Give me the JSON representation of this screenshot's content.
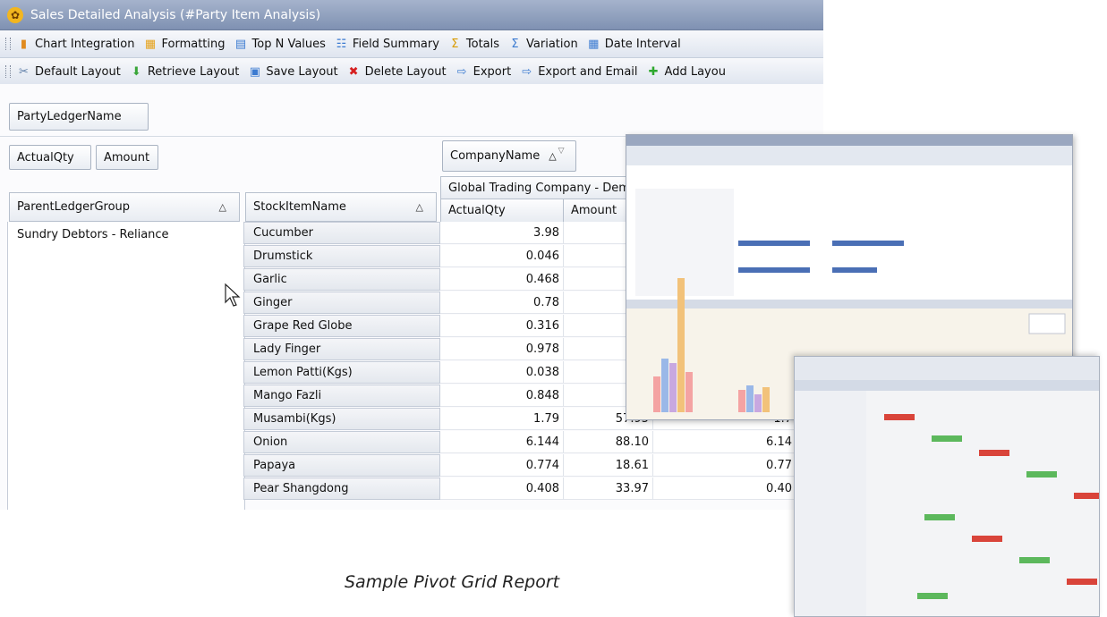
{
  "window": {
    "title": "Sales Detailed Analysis  (#Party Item Analysis)"
  },
  "toolbar1": [
    {
      "label": "Chart Integration",
      "icon": "chart-icon",
      "color": "#e08a1e"
    },
    {
      "label": "Formatting",
      "icon": "formatting-icon",
      "color": "#e6a21a"
    },
    {
      "label": "Top N Values",
      "icon": "top-n-icon",
      "color": "#3c7bd1"
    },
    {
      "label": "Field Summary",
      "icon": "field-summary-icon",
      "color": "#3c7bd1"
    },
    {
      "label": "Totals",
      "icon": "sigma-icon",
      "color": "#d99b00"
    },
    {
      "label": "Variation",
      "icon": "variation-icon",
      "color": "#3c7bd1"
    },
    {
      "label": "Date Interval",
      "icon": "calendar-icon",
      "color": "#3c7bd1"
    }
  ],
  "toolbar2": [
    {
      "label": "Default Layout",
      "icon": "tools-icon",
      "color": "#5f7fa8"
    },
    {
      "label": "Retrieve Layout",
      "icon": "download-icon",
      "color": "#3aa63a"
    },
    {
      "label": "Save Layout",
      "icon": "save-icon",
      "color": "#3c7bd1"
    },
    {
      "label": "Delete Layout",
      "icon": "delete-x-icon",
      "color": "#d62020"
    },
    {
      "label": "Export",
      "icon": "export-icon",
      "color": "#3c7bd1"
    },
    {
      "label": "Export and Email",
      "icon": "export-email-icon",
      "color": "#3c7bd1"
    },
    {
      "label": "Add Layou",
      "icon": "add-icon",
      "color": "#2ea82e"
    }
  ],
  "pivot": {
    "filter_field": "PartyLedgerName",
    "data_fields": [
      "ActualQty",
      "Amount"
    ],
    "column_field": "CompanyName",
    "row_fields": [
      "ParentLedgerGroup",
      "StockItemName"
    ],
    "company_header": "Global Trading Company - Dem",
    "value_headers": [
      "ActualQty",
      "Amount"
    ],
    "group_value": "Sundry Debtors - Reliance",
    "rows": [
      {
        "item": "Cucumber",
        "qty": "3.98",
        "amount": "",
        "qty2": ""
      },
      {
        "item": "Drumstick",
        "qty": "0.046",
        "amount": "",
        "qty2": ""
      },
      {
        "item": "Garlic",
        "qty": "0.468",
        "amount": "",
        "qty2": ""
      },
      {
        "item": "Ginger",
        "qty": "0.78",
        "amount": "",
        "qty2": ""
      },
      {
        "item": "Grape Red Globe",
        "qty": "0.316",
        "amount": "",
        "qty2": ""
      },
      {
        "item": "Lady Finger",
        "qty": "0.978",
        "amount": "",
        "qty2": ""
      },
      {
        "item": "Lemon Patti(Kgs)",
        "qty": "0.038",
        "amount": "",
        "qty2": ""
      },
      {
        "item": "Mango Fazli",
        "qty": "0.848",
        "amount": "",
        "qty2": ""
      },
      {
        "item": "Musambi(Kgs)",
        "qty": "1.79",
        "amount": "57.95",
        "qty2": "1.7"
      },
      {
        "item": "Onion",
        "qty": "6.144",
        "amount": "88.10",
        "qty2": "6.14"
      },
      {
        "item": "Papaya",
        "qty": "0.774",
        "amount": "18.61",
        "qty2": "0.77"
      },
      {
        "item": "Pear Shangdong",
        "qty": "0.408",
        "amount": "33.97",
        "qty2": "0.40"
      }
    ]
  },
  "caption": "Sample Pivot Grid Report",
  "colors": {
    "titlebar": "#8f9fbd",
    "accent_blue": "#4a6fb5",
    "red": "#d9443a",
    "green": "#5cb85c"
  }
}
